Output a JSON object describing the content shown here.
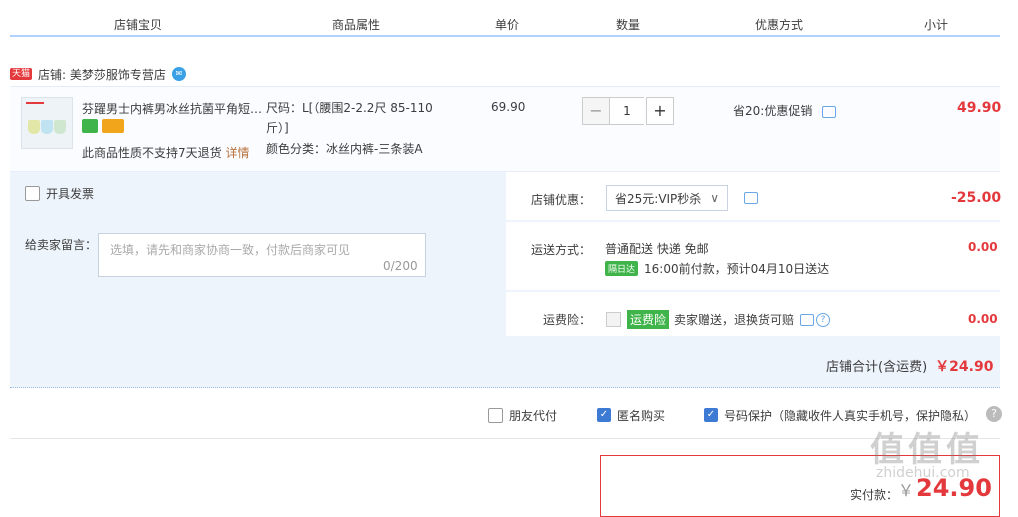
{
  "columns": [
    "店铺宝贝",
    "商品属性",
    "单价",
    "数量",
    "优惠方式",
    "小计"
  ],
  "shop": {
    "badge": "天猫",
    "name": "店铺: 美梦莎服饰专营店"
  },
  "item": {
    "title": "芬躍男士内裤男冰丝抗菌平角短…",
    "returns_note": "此商品性质不支持7天退货",
    "detail_link": "详情",
    "attr_size_line1": "尺码：L[（腰围2-2.2尺 85-110",
    "attr_size_line2": "斤）]",
    "attr_color": "颜色分类：冰丝内裤-三条装A",
    "unit_price": "69.90",
    "quantity": "1",
    "promo": "省20:优惠促销",
    "subtotal": "49.90"
  },
  "options": {
    "invoice": "开具发票",
    "message_label": "给卖家留言：",
    "message_placeholder": "选填，请先和商家协商一致，付款后商家可见",
    "message_count": "0/200",
    "shop_discount_label": "店铺优惠：",
    "shop_discount_value": "省25元:VIP秒杀",
    "shop_discount_amount": "-25.00",
    "shipping_label": "运送方式：",
    "shipping_method": "普通配送 快递 免邮",
    "shipping_badge": "隔日达",
    "shipping_time": "16:00前付款，预计04月10日送达",
    "shipping_amount": "0.00",
    "insurance_label": "运费险：",
    "insurance_badge": "运费险",
    "insurance_text": "卖家赠送，退换货可赔",
    "insurance_amount": "0.00",
    "shop_total_label": "店铺合计(含运费)",
    "shop_total_value": "￥24.90"
  },
  "checkout": {
    "friend_pay": "朋友代付",
    "anonymous": "匿名购买",
    "number_protect": "号码保护（隐藏收件人真实手机号，保护隐私）",
    "pay_label": "实付款：",
    "pay_currency": "￥",
    "pay_value": "24.90"
  },
  "watermark": {
    "logo": "值值值",
    "site": "zhidehui.com"
  }
}
